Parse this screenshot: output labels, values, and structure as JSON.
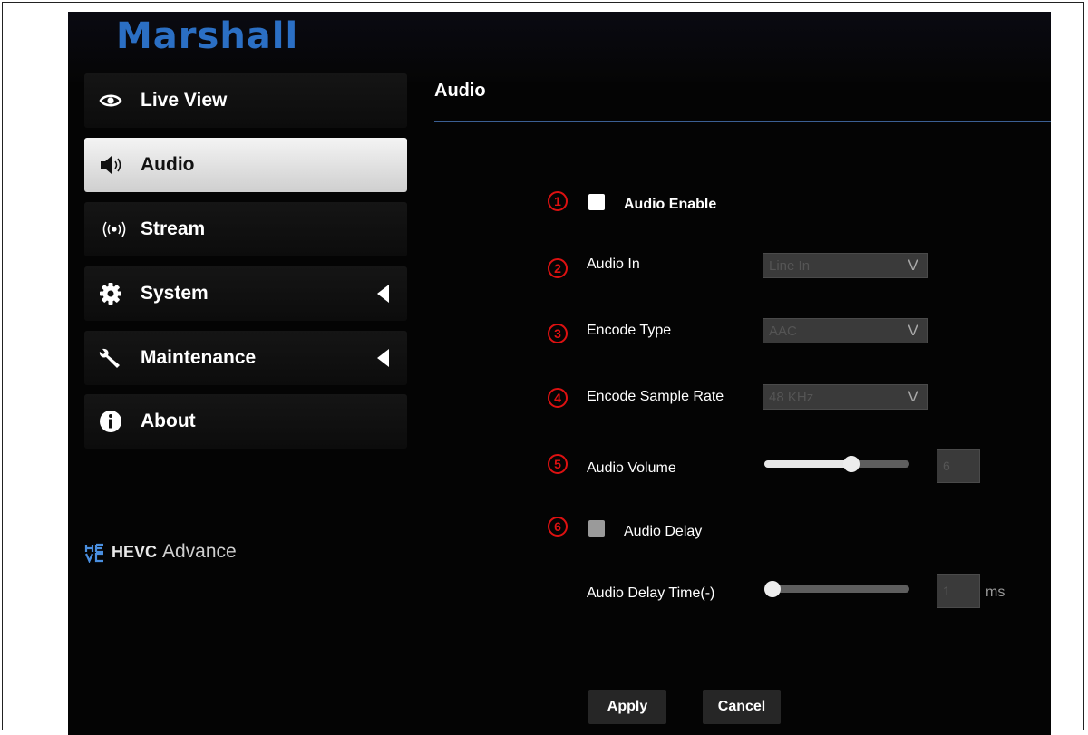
{
  "brand": {
    "logo_text": "Marshall",
    "color": "#2b6fc4"
  },
  "sidebar": {
    "items": [
      {
        "label": "Live View",
        "icon": "eye-icon",
        "active": false,
        "has_arrow": false
      },
      {
        "label": "Audio",
        "icon": "speaker-icon",
        "active": true,
        "has_arrow": false
      },
      {
        "label": "Stream",
        "icon": "broadcast-icon",
        "active": false,
        "has_arrow": false
      },
      {
        "label": "System",
        "icon": "gear-icon",
        "active": false,
        "has_arrow": true
      },
      {
        "label": "Maintenance",
        "icon": "wrench-icon",
        "active": false,
        "has_arrow": true
      },
      {
        "label": "About",
        "icon": "info-icon",
        "active": false,
        "has_arrow": false
      }
    ],
    "footer_logo": {
      "word1": "HEVC",
      "word2": "Advance"
    }
  },
  "main": {
    "title": "Audio",
    "rows": [
      {
        "badge": "1",
        "label": "Audio Enable",
        "control": "checkbox",
        "checked": false
      },
      {
        "badge": "2",
        "label": "Audio In",
        "control": "select",
        "value": "Line In"
      },
      {
        "badge": "3",
        "label": "Encode Type",
        "control": "select",
        "value": "AAC"
      },
      {
        "badge": "4",
        "label": "Encode Sample Rate",
        "control": "select",
        "value": "48 KHz"
      },
      {
        "badge": "5",
        "label": "Audio Volume",
        "control": "slider",
        "value": "6",
        "level": 0.6
      },
      {
        "badge": "6",
        "label": "Audio Delay",
        "control": "checkbox",
        "checked": false,
        "disabled": true
      },
      {
        "badge": "",
        "label": "Audio Delay Time(-)",
        "control": "slider",
        "value": "1",
        "unit": "ms",
        "level": 0.0
      }
    ],
    "buttons": {
      "apply": "Apply",
      "cancel": "Cancel"
    }
  },
  "colors": {
    "badge": "#dd1111",
    "rule": "#3b5f93",
    "active_nav": "#e6e6e6"
  }
}
